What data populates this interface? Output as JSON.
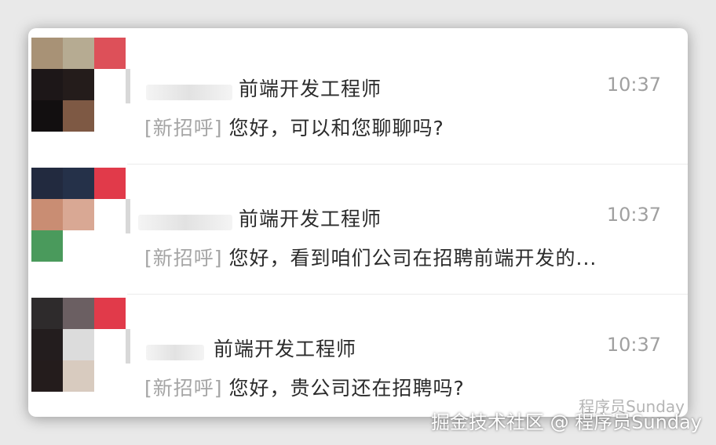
{
  "conversations": [
    {
      "title": "前端开发工程师",
      "time": "10:37",
      "tag": "[新招呼]",
      "message": "您好，可以和您聊聊吗?",
      "avatar_colors": [
        "#a89276",
        "#b6ab92",
        "#dd5059",
        "#1d1718",
        "#241c1b",
        "#ffffff",
        "#120f10",
        "#7e5944",
        "#ffffff"
      ]
    },
    {
      "title": "前端开发工程师",
      "time": "10:37",
      "tag": "[新招呼]",
      "message": "您好，看到咱们公司在招聘前端开发的...",
      "avatar_colors": [
        "#222a3f",
        "#253149",
        "#e13a4a",
        "#c98d73",
        "#d9a894",
        "#ffffff",
        "#4a9a5c",
        "#ffffff",
        "#ffffff"
      ]
    },
    {
      "title": "前端开发工程师",
      "time": "10:37",
      "tag": "[新招呼]",
      "message": "您好，贵公司还在招聘吗?",
      "avatar_colors": [
        "#2e2b2c",
        "#6b5f62",
        "#e13a4a",
        "#231d1e",
        "#dcdcdc",
        "#ffffff",
        "#241c1c",
        "#d8cbbf",
        "#ffffff"
      ]
    }
  ],
  "watermark": "掘金技术社区 @ 程序员Sunday",
  "watermark_secondary": "程序员Sunday"
}
